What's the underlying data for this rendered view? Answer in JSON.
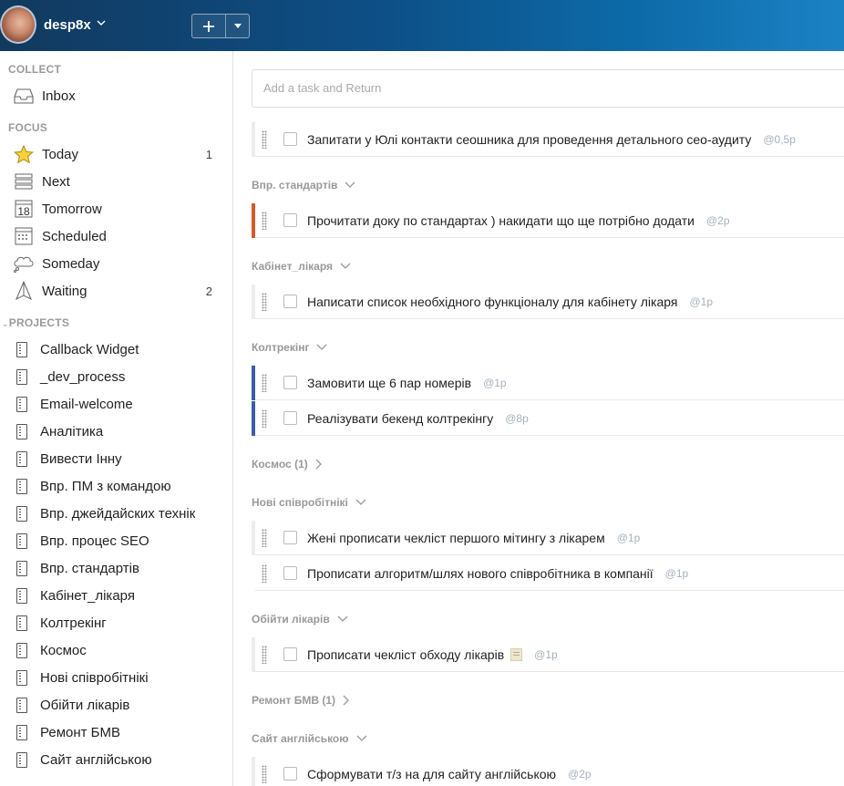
{
  "header": {
    "username": "desp8x",
    "add_label": "+",
    "dropdown_label": "▾"
  },
  "colors": {
    "accent_orange": "#d35b2a",
    "accent_blue": "#3f5ba9"
  },
  "sidebar": {
    "collect_title": "COLLECT",
    "focus_title": "FOCUS",
    "projects_title": "PROJECTS",
    "collect_items": [
      {
        "label": "Inbox",
        "icon": "inbox-icon"
      }
    ],
    "focus_items": [
      {
        "label": "Today",
        "icon": "star-icon",
        "count": "1"
      },
      {
        "label": "Next",
        "icon": "next-icon",
        "count": ""
      },
      {
        "label": "Tomorrow",
        "icon": "calendar-18-icon",
        "count": "",
        "icon_text": "18"
      },
      {
        "label": "Scheduled",
        "icon": "scheduled-calendar-icon",
        "count": ""
      },
      {
        "label": "Someday",
        "icon": "cloud-icon",
        "count": ""
      },
      {
        "label": "Waiting",
        "icon": "waiting-sail-icon",
        "count": "2"
      }
    ],
    "projects": [
      "Callback Widget",
      "_dev_process",
      "Email-welcome",
      "Аналітика",
      "Вивести Інну",
      "Впр. ПМ з командою",
      "Впр. джейдайских технік",
      "Впр. процес SEO",
      "Впр. стандартів",
      "Кабінет_лікаря",
      "Колтрекінг",
      "Космос",
      "Нові співробітнікі",
      "Обійти лікарів",
      "Ремонт БМВ",
      "Сайт англійською"
    ]
  },
  "main": {
    "add_placeholder": "Add a task and Return",
    "tasks": [
      {
        "title": "Запитати у Юлі контакти сеошника для проведення детального сео-аудиту",
        "tag": "@0,5p"
      },
      {
        "title": "Прочитати доку по стандартах ) накидати що ще потрібно додати",
        "tag": "@2p"
      },
      {
        "title": "Написати список необхідного функціоналу для кабінету лікаря",
        "tag": "@1p"
      },
      {
        "title": "Замовити ще 6 пар номерів",
        "tag": "@1p"
      },
      {
        "title": "Реалізувати бекенд колтрекінгу",
        "tag": "@8p"
      },
      {
        "title": "Жені прописати чекліст першого мітингу з лікарем",
        "tag": "@1p"
      },
      {
        "title": "Прописати алгоритм/шлях нового співробітника в компанії",
        "tag": "@1p"
      },
      {
        "title": "Прописати чекліст обходу лікарів",
        "tag": "@1p"
      },
      {
        "title": "Сформувати т/з на для сайту англійською",
        "tag": "@2p"
      }
    ],
    "groups": [
      {
        "label": "Впр. стандартів",
        "expanded": true
      },
      {
        "label": "Кабінет_лікаря",
        "expanded": true
      },
      {
        "label": "Колтрекінг",
        "expanded": true
      },
      {
        "label": "Космос (1)",
        "expanded": false
      },
      {
        "label": "Нові співробітнікі",
        "expanded": true
      },
      {
        "label": "Обійти лікарів",
        "expanded": true
      },
      {
        "label": "Ремонт БМВ (1)",
        "expanded": false
      },
      {
        "label": "Сайт англійською",
        "expanded": true
      }
    ]
  }
}
